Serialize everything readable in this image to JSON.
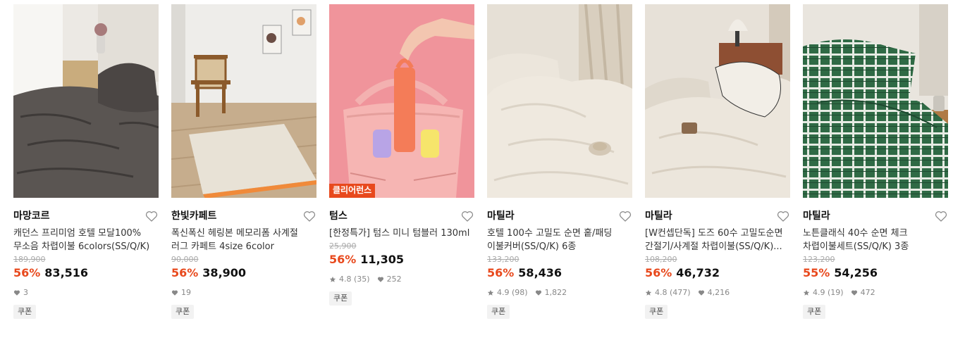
{
  "products": [
    {
      "brand": "마망코르",
      "title": "캐던스 프리미엄 호텔 모달100% 무소음 차렵이불 6colors(SS/Q/K)",
      "original_price": "189,900",
      "discount": "56%",
      "price": "83,516",
      "rating": "",
      "reviews": "",
      "likes": "3",
      "coupon": "쿠폰",
      "image_badge": "",
      "heart_icon": "heart-outline-icon"
    },
    {
      "brand": "한빛카페트",
      "title": "폭신폭신 헤링본 메모리폼 사계절 러그 카페트 4size 6color",
      "original_price": "90,000",
      "discount": "56%",
      "price": "38,900",
      "rating": "",
      "reviews": "",
      "likes": "19",
      "coupon": "쿠폰",
      "image_badge": "",
      "heart_icon": "heart-outline-icon"
    },
    {
      "brand": "텀스",
      "title": "[한정특가] 텀스 미니 텀블러 130ml",
      "original_price": "25,900",
      "discount": "56%",
      "price": "11,305",
      "rating": "4.8",
      "reviews": "(35)",
      "likes": "252",
      "coupon": "쿠폰",
      "image_badge": "클리어런스",
      "heart_icon": "heart-outline-icon"
    },
    {
      "brand": "마틸라",
      "title": "호텔 100수 고밀도 순면 홑/패딩 이불커버(SS/Q/K) 6종",
      "original_price": "133,200",
      "discount": "56%",
      "price": "58,436",
      "rating": "4.9",
      "reviews": "(98)",
      "likes": "1,822",
      "coupon": "쿠폰",
      "image_badge": "",
      "heart_icon": "heart-outline-icon"
    },
    {
      "brand": "마틸라",
      "title": "[W컨셉단독] 도즈 60수 고밀도순면 간절기/사계절 차렵이불(SS/Q/K)...",
      "original_price": "108,200",
      "discount": "56%",
      "price": "46,732",
      "rating": "4.8",
      "reviews": "(477)",
      "likes": "4,216",
      "coupon": "쿠폰",
      "image_badge": "",
      "heart_icon": "heart-outline-icon"
    },
    {
      "brand": "마틸라",
      "title": "노튼클래식 40수 순면 체크 차렵이불세트(SS/Q/K) 3종",
      "original_price": "123,200",
      "discount": "55%",
      "price": "54,256",
      "rating": "4.9",
      "reviews": "(19)",
      "likes": "472",
      "coupon": "쿠폰",
      "image_badge": "",
      "heart_icon": "heart-outline-icon"
    }
  ],
  "colors": {
    "discount": "#e8491d",
    "badge_bg": "#e8491d",
    "muted": "#888888",
    "coupon_bg": "#f2f2f2"
  }
}
